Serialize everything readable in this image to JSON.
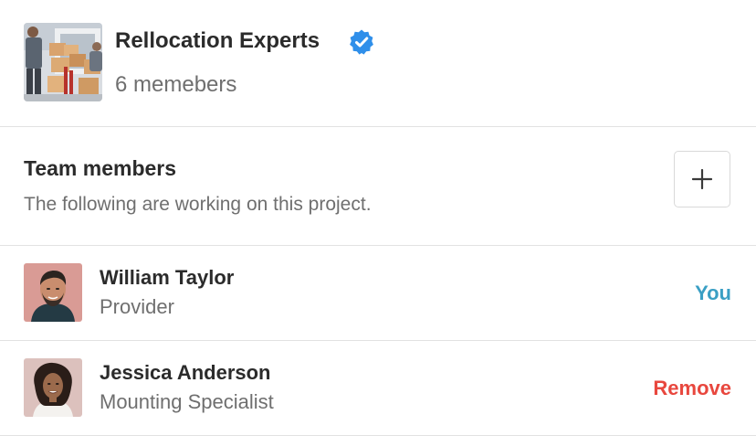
{
  "team": {
    "name": "Rellocation Experts",
    "member_count": "6 memebers",
    "verified_icon": "verified-badge-icon",
    "verified_color": "#2f8fea"
  },
  "section": {
    "title": "Team members",
    "subtitle": "The following are working on this project.",
    "add_icon": "plus-icon"
  },
  "members": [
    {
      "name": "William Taylor",
      "role": "Provider",
      "status": "You",
      "status_color": "#3a9fc4"
    },
    {
      "name": "Jessica Anderson",
      "role": "Mounting Specialist",
      "action": "Remove",
      "action_color": "#e8473e"
    }
  ]
}
